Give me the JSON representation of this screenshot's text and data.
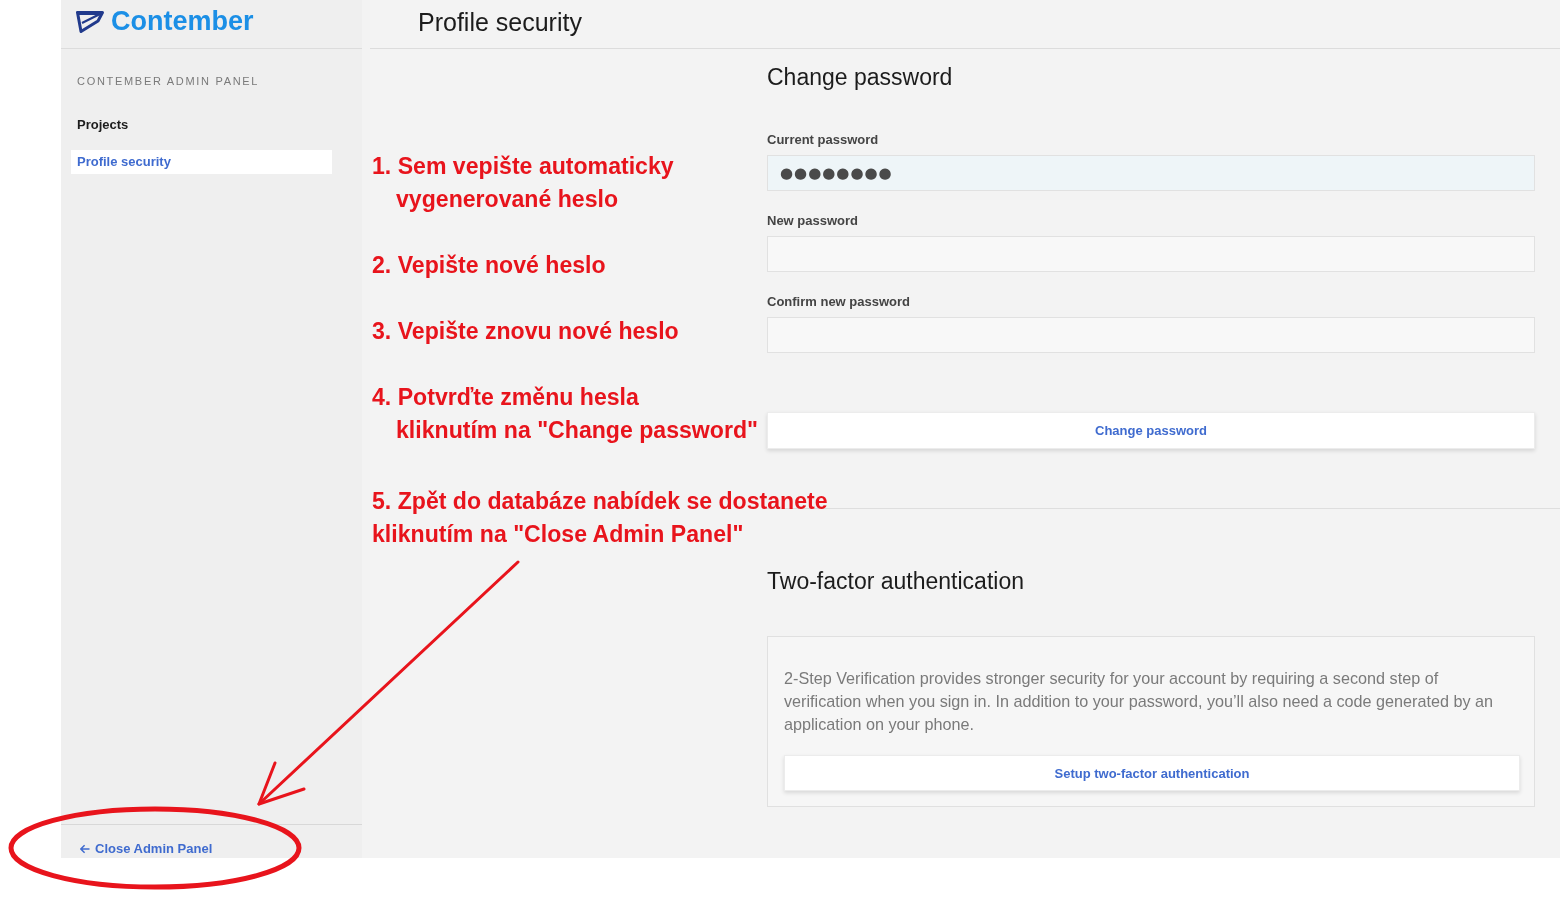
{
  "sidebar": {
    "logo": {
      "text": "Contember"
    },
    "panel_title": "CONTEMBER ADMIN PANEL",
    "items": [
      {
        "label": "Projects",
        "selected": false
      },
      {
        "label": "Profile security",
        "selected": true
      }
    ],
    "footer_link": "Close Admin Panel"
  },
  "header": {
    "title": "Profile security"
  },
  "change_password": {
    "title": "Change password",
    "fields": [
      {
        "label": "Current password",
        "value": "●●●●●●●●"
      },
      {
        "label": "New password"
      },
      {
        "label": "Confirm new password"
      }
    ],
    "button": "Change password"
  },
  "two_factor": {
    "title": "Two-factor authentication",
    "description": "2-Step Verification provides stronger security for your account by requiring a second step of verification when you sign in. In addition to your password, you’ll also need a code generated by an application on your phone.",
    "button": "Setup two-factor authentication"
  },
  "annotations": [
    {
      "lines": [
        "1. Sem vepište automaticky",
        "vygenerované heslo"
      ],
      "hanging_indent": true
    },
    {
      "lines": [
        "2. Vepište nové heslo"
      ]
    },
    {
      "lines": [
        "3. Vepište znovu nové heslo"
      ]
    },
    {
      "lines": [
        "4. Potvrďte změnu hesla",
        "kliknutím na \"Change password\""
      ],
      "hanging_indent": true
    },
    {
      "lines": [
        "5. Zpět do databáze nabídek se dostanete",
        "kliknutím na \"Close Admin Panel\""
      ],
      "hanging_indent": false
    }
  ]
}
